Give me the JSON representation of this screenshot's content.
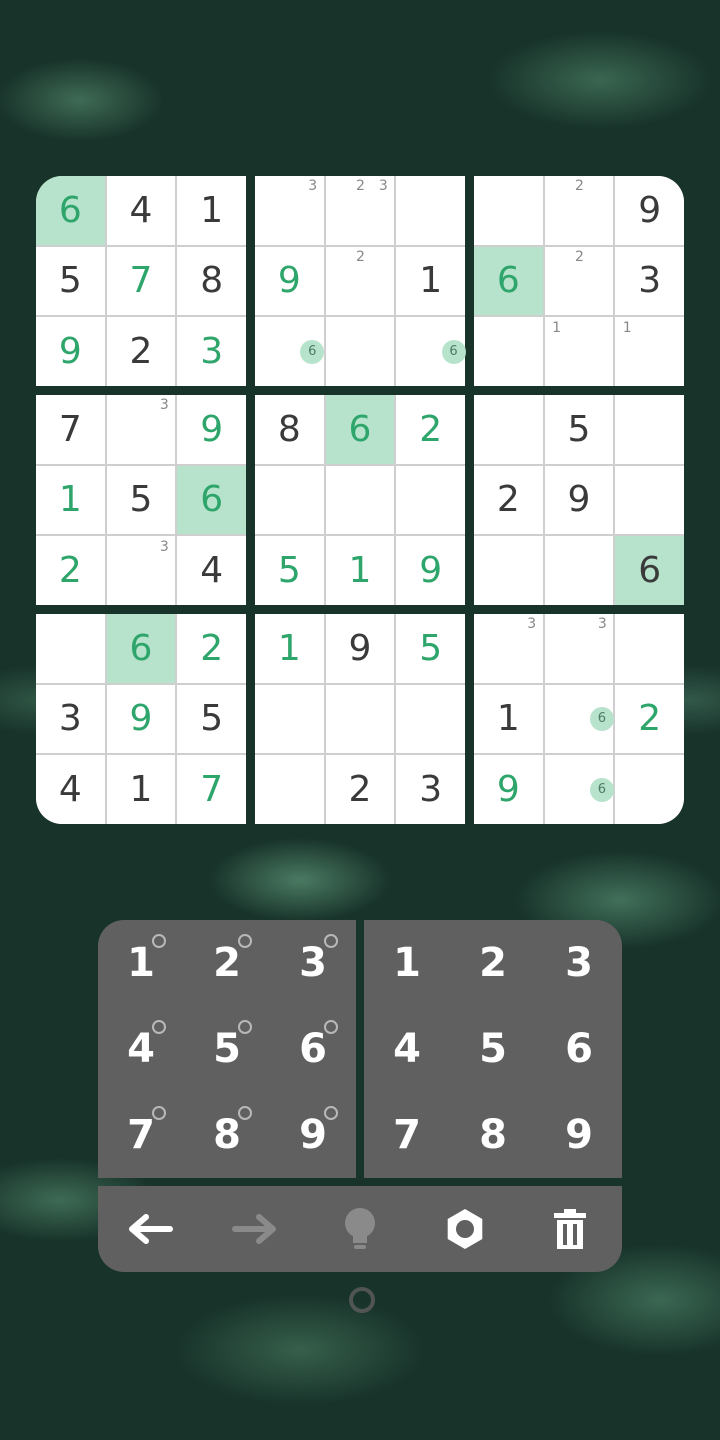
{
  "board": {
    "boxes": [
      {
        "cells": [
          {
            "value": "6",
            "kind": "user",
            "highlight": true,
            "notes": []
          },
          {
            "value": "4",
            "kind": "given",
            "highlight": false,
            "notes": []
          },
          {
            "value": "1",
            "kind": "given",
            "highlight": false,
            "notes": []
          },
          {
            "value": "5",
            "kind": "given",
            "highlight": false,
            "notes": []
          },
          {
            "value": "7",
            "kind": "user",
            "highlight": false,
            "notes": []
          },
          {
            "value": "8",
            "kind": "given",
            "highlight": false,
            "notes": []
          },
          {
            "value": "9",
            "kind": "user",
            "highlight": false,
            "notes": []
          },
          {
            "value": "2",
            "kind": "given",
            "highlight": false,
            "notes": []
          },
          {
            "value": "3",
            "kind": "user",
            "highlight": false,
            "notes": []
          }
        ]
      },
      {
        "cells": [
          {
            "value": "",
            "kind": "empty",
            "highlight": false,
            "notes": [
              {
                "d": "3",
                "slot": 3,
                "circle": false
              }
            ]
          },
          {
            "value": "",
            "kind": "empty",
            "highlight": false,
            "notes": [
              {
                "d": "2",
                "slot": 2,
                "circle": false
              },
              {
                "d": "3",
                "slot": 3,
                "circle": false
              }
            ]
          },
          {
            "value": "",
            "kind": "empty",
            "highlight": false,
            "notes": []
          },
          {
            "value": "9",
            "kind": "user",
            "highlight": false,
            "notes": []
          },
          {
            "value": "",
            "kind": "empty",
            "highlight": false,
            "notes": [
              {
                "d": "2",
                "slot": 2,
                "circle": false
              }
            ]
          },
          {
            "value": "1",
            "kind": "given",
            "highlight": false,
            "notes": []
          },
          {
            "value": "",
            "kind": "empty",
            "highlight": false,
            "notes": [
              {
                "d": "6",
                "slot": 6,
                "circle": true
              }
            ]
          },
          {
            "value": "",
            "kind": "empty",
            "highlight": false,
            "notes": []
          },
          {
            "value": "",
            "kind": "empty",
            "highlight": false,
            "notes": [
              {
                "d": "6",
                "slot": 6,
                "circle": true
              }
            ]
          }
        ]
      },
      {
        "cells": [
          {
            "value": "",
            "kind": "empty",
            "highlight": false,
            "notes": []
          },
          {
            "value": "",
            "kind": "empty",
            "highlight": false,
            "notes": [
              {
                "d": "2",
                "slot": 2,
                "circle": false
              }
            ]
          },
          {
            "value": "9",
            "kind": "given",
            "highlight": false,
            "notes": []
          },
          {
            "value": "6",
            "kind": "user",
            "highlight": true,
            "notes": []
          },
          {
            "value": "",
            "kind": "empty",
            "highlight": false,
            "notes": [
              {
                "d": "2",
                "slot": 2,
                "circle": false
              }
            ]
          },
          {
            "value": "3",
            "kind": "given",
            "highlight": false,
            "notes": []
          },
          {
            "value": "",
            "kind": "empty",
            "highlight": false,
            "notes": []
          },
          {
            "value": "",
            "kind": "empty",
            "highlight": false,
            "notes": [
              {
                "d": "1",
                "slot": 1,
                "circle": false
              }
            ]
          },
          {
            "value": "",
            "kind": "empty",
            "highlight": false,
            "notes": [
              {
                "d": "1",
                "slot": 1,
                "circle": false
              }
            ]
          }
        ]
      },
      {
        "cells": [
          {
            "value": "7",
            "kind": "given",
            "highlight": false,
            "notes": []
          },
          {
            "value": "",
            "kind": "empty",
            "highlight": false,
            "notes": [
              {
                "d": "3",
                "slot": 3,
                "circle": false
              }
            ]
          },
          {
            "value": "9",
            "kind": "user",
            "highlight": false,
            "notes": []
          },
          {
            "value": "1",
            "kind": "user",
            "highlight": false,
            "notes": []
          },
          {
            "value": "5",
            "kind": "given",
            "highlight": false,
            "notes": []
          },
          {
            "value": "6",
            "kind": "user",
            "highlight": true,
            "notes": []
          },
          {
            "value": "2",
            "kind": "user",
            "highlight": false,
            "notes": []
          },
          {
            "value": "",
            "kind": "empty",
            "highlight": false,
            "notes": [
              {
                "d": "3",
                "slot": 3,
                "circle": false
              }
            ]
          },
          {
            "value": "4",
            "kind": "given",
            "highlight": false,
            "notes": []
          }
        ]
      },
      {
        "cells": [
          {
            "value": "8",
            "kind": "given",
            "highlight": false,
            "notes": []
          },
          {
            "value": "6",
            "kind": "user",
            "highlight": true,
            "notes": []
          },
          {
            "value": "2",
            "kind": "user",
            "highlight": false,
            "notes": []
          },
          {
            "value": "",
            "kind": "empty",
            "highlight": false,
            "notes": []
          },
          {
            "value": "",
            "kind": "empty",
            "highlight": false,
            "notes": []
          },
          {
            "value": "",
            "kind": "empty",
            "highlight": false,
            "notes": []
          },
          {
            "value": "5",
            "kind": "user",
            "highlight": false,
            "notes": []
          },
          {
            "value": "1",
            "kind": "user",
            "highlight": false,
            "notes": []
          },
          {
            "value": "9",
            "kind": "user",
            "highlight": false,
            "notes": []
          }
        ]
      },
      {
        "cells": [
          {
            "value": "",
            "kind": "empty",
            "highlight": false,
            "notes": []
          },
          {
            "value": "5",
            "kind": "given",
            "highlight": false,
            "notes": []
          },
          {
            "value": "",
            "kind": "empty",
            "highlight": false,
            "notes": []
          },
          {
            "value": "2",
            "kind": "given",
            "highlight": false,
            "notes": []
          },
          {
            "value": "9",
            "kind": "given",
            "highlight": false,
            "notes": []
          },
          {
            "value": "",
            "kind": "empty",
            "highlight": false,
            "notes": []
          },
          {
            "value": "",
            "kind": "empty",
            "highlight": false,
            "notes": []
          },
          {
            "value": "",
            "kind": "empty",
            "highlight": false,
            "notes": []
          },
          {
            "value": "6",
            "kind": "given",
            "highlight": true,
            "notes": []
          }
        ]
      },
      {
        "cells": [
          {
            "value": "",
            "kind": "empty",
            "highlight": false,
            "notes": []
          },
          {
            "value": "6",
            "kind": "user",
            "highlight": true,
            "notes": []
          },
          {
            "value": "2",
            "kind": "user",
            "highlight": false,
            "notes": []
          },
          {
            "value": "3",
            "kind": "given",
            "highlight": false,
            "notes": []
          },
          {
            "value": "9",
            "kind": "user",
            "highlight": false,
            "notes": []
          },
          {
            "value": "5",
            "kind": "given",
            "highlight": false,
            "notes": []
          },
          {
            "value": "4",
            "kind": "given",
            "highlight": false,
            "notes": []
          },
          {
            "value": "1",
            "kind": "given",
            "highlight": false,
            "notes": []
          },
          {
            "value": "7",
            "kind": "user",
            "highlight": false,
            "notes": []
          }
        ]
      },
      {
        "cells": [
          {
            "value": "1",
            "kind": "user",
            "highlight": false,
            "notes": []
          },
          {
            "value": "9",
            "kind": "given",
            "highlight": false,
            "notes": []
          },
          {
            "value": "5",
            "kind": "user",
            "highlight": false,
            "notes": []
          },
          {
            "value": "",
            "kind": "empty",
            "highlight": false,
            "notes": []
          },
          {
            "value": "",
            "kind": "empty",
            "highlight": false,
            "notes": []
          },
          {
            "value": "",
            "kind": "empty",
            "highlight": false,
            "notes": []
          },
          {
            "value": "",
            "kind": "empty",
            "highlight": false,
            "notes": []
          },
          {
            "value": "2",
            "kind": "given",
            "highlight": false,
            "notes": []
          },
          {
            "value": "3",
            "kind": "given",
            "highlight": false,
            "notes": []
          }
        ]
      },
      {
        "cells": [
          {
            "value": "",
            "kind": "empty",
            "highlight": false,
            "notes": [
              {
                "d": "3",
                "slot": 3,
                "circle": false
              }
            ]
          },
          {
            "value": "",
            "kind": "empty",
            "highlight": false,
            "notes": [
              {
                "d": "3",
                "slot": 3,
                "circle": false
              }
            ]
          },
          {
            "value": "",
            "kind": "empty",
            "highlight": false,
            "notes": []
          },
          {
            "value": "1",
            "kind": "given",
            "highlight": false,
            "notes": []
          },
          {
            "value": "",
            "kind": "empty",
            "highlight": false,
            "notes": [
              {
                "d": "6",
                "slot": 6,
                "circle": true
              }
            ]
          },
          {
            "value": "2",
            "kind": "user",
            "highlight": false,
            "notes": []
          },
          {
            "value": "9",
            "kind": "user",
            "highlight": false,
            "notes": []
          },
          {
            "value": "",
            "kind": "empty",
            "highlight": false,
            "notes": [
              {
                "d": "6",
                "slot": 6,
                "circle": true
              }
            ]
          },
          {
            "value": "",
            "kind": "empty",
            "highlight": false,
            "notes": []
          }
        ]
      }
    ]
  },
  "notes_pad": {
    "keys": [
      "1",
      "2",
      "3",
      "4",
      "5",
      "6",
      "7",
      "8",
      "9"
    ]
  },
  "number_pad": {
    "keys": [
      "1",
      "2",
      "3",
      "4",
      "5",
      "6",
      "7",
      "8",
      "9"
    ]
  },
  "toolbar": {
    "tools": [
      {
        "name": "undo-icon",
        "enabled": true
      },
      {
        "name": "redo-icon",
        "enabled": false
      },
      {
        "name": "hint-bulb-icon",
        "enabled": false
      },
      {
        "name": "settings-gear-icon",
        "enabled": true
      },
      {
        "name": "delete-trash-icon",
        "enabled": true
      }
    ]
  },
  "colors": {
    "user_digit": "#2ea56a",
    "given_digit": "#3a3a3a",
    "highlight": "#b7e2cc",
    "pad_bg": "#606060",
    "note_digit": "#888888"
  }
}
